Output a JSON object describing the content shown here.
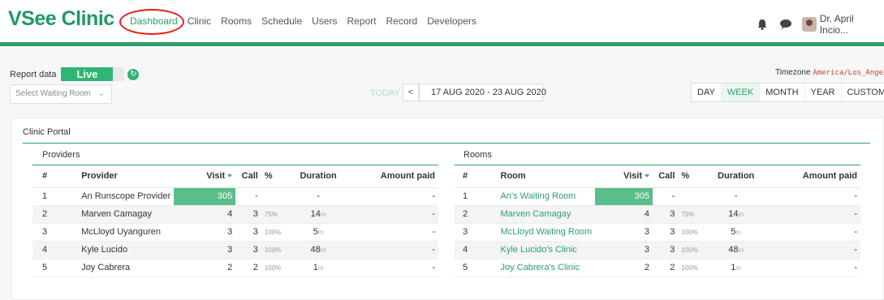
{
  "app": {
    "logo": "VSee Clinic",
    "nav": [
      "Dashboard",
      "Clinic",
      "Rooms",
      "Schedule",
      "Users",
      "Report",
      "Record",
      "Developers"
    ],
    "active_nav": "Dashboard",
    "user_name": "Dr. April Incio...",
    "accent_color": "#2e9e6a"
  },
  "controls": {
    "report_data_label": "Report data",
    "live_label": "Live",
    "waiting_room_placeholder": "Select Waiting Room",
    "today_label": "TODAY",
    "prev_label": "<",
    "date_range": "17 AUG 2020 - 23 AUG 2020",
    "timezone_label": "Timezone",
    "timezone_value": "America/Los_Angeles",
    "periods": [
      "DAY",
      "WEEK",
      "MONTH",
      "YEAR",
      "CUSTOM"
    ],
    "selected_period": "WEEK"
  },
  "panel": {
    "title": "Clinic Portal",
    "providers": {
      "title": "Providers",
      "headers": [
        "#",
        "Provider",
        "Visit",
        "Call",
        "%",
        "Duration",
        "Amount paid"
      ],
      "rows": [
        {
          "n": "1",
          "name": "An Runscope Provider",
          "visit": "305",
          "call": "-",
          "pct": "",
          "dur": "-",
          "unit": "",
          "paid": "-"
        },
        {
          "n": "2",
          "name": "Marven Camagay",
          "visit": "4",
          "call": "3",
          "pct": "75%",
          "dur": "14",
          "unit": "m",
          "paid": "-"
        },
        {
          "n": "3",
          "name": "McLloyd Uyanguren",
          "visit": "3",
          "call": "3",
          "pct": "100%",
          "dur": "5",
          "unit": "m",
          "paid": "-"
        },
        {
          "n": "4",
          "name": "Kyle Lucido",
          "visit": "3",
          "call": "3",
          "pct": "100%",
          "dur": "48",
          "unit": "m",
          "paid": "-"
        },
        {
          "n": "5",
          "name": "Joy Cabrera",
          "visit": "2",
          "call": "2",
          "pct": "100%",
          "dur": "1",
          "unit": "m",
          "paid": "-"
        }
      ]
    },
    "rooms": {
      "title": "Rooms",
      "headers": [
        "#",
        "Room",
        "Visit",
        "Call",
        "%",
        "Duration",
        "Amount paid"
      ],
      "rows": [
        {
          "n": "1",
          "name": "An's Waiting Room",
          "visit": "305",
          "call": "-",
          "pct": "",
          "dur": "-",
          "unit": "",
          "paid": "-"
        },
        {
          "n": "2",
          "name": "Marven Camagay",
          "visit": "4",
          "call": "3",
          "pct": "75%",
          "dur": "14",
          "unit": "m",
          "paid": "-"
        },
        {
          "n": "3",
          "name": "McLloyd Waiting Room",
          "visit": "3",
          "call": "3",
          "pct": "100%",
          "dur": "5",
          "unit": "m",
          "paid": "-"
        },
        {
          "n": "4",
          "name": "Kyle Lucido's Clinic",
          "visit": "3",
          "call": "3",
          "pct": "100%",
          "dur": "48",
          "unit": "m",
          "paid": "-"
        },
        {
          "n": "5",
          "name": "Joy Cabrera's Clinic",
          "visit": "2",
          "call": "2",
          "pct": "100%",
          "dur": "1",
          "unit": "m",
          "paid": "-"
        }
      ]
    }
  }
}
